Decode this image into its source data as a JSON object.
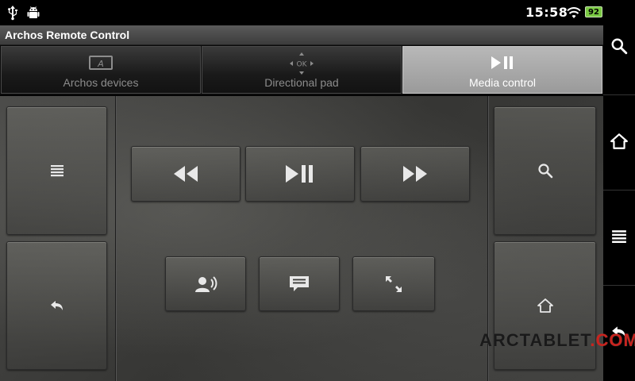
{
  "status_bar": {
    "time": "15:58",
    "battery_level": "92",
    "icons": [
      "usb-icon",
      "android-debug-icon",
      "wifi-icon",
      "battery-icon"
    ]
  },
  "app": {
    "title": "Archos Remote Control"
  },
  "tabs": [
    {
      "label": "Archos devices",
      "icon": "archos-device-icon",
      "active": false
    },
    {
      "label": "Directional pad",
      "icon": "dpad-icon",
      "dpad_center": "OK",
      "active": false
    },
    {
      "label": "Media control",
      "icon": "play-pause-icon",
      "active": true
    }
  ],
  "left_buttons": [
    {
      "icon": "menu-icon"
    },
    {
      "icon": "back-icon"
    }
  ],
  "transport_buttons": [
    {
      "icon": "rewind-icon"
    },
    {
      "icon": "play-pause-icon"
    },
    {
      "icon": "fast-forward-icon"
    }
  ],
  "function_buttons": [
    {
      "icon": "audio-track-icon"
    },
    {
      "icon": "subtitles-icon"
    },
    {
      "icon": "fullscreen-icon"
    }
  ],
  "right_buttons": [
    {
      "icon": "search-icon"
    },
    {
      "icon": "home-icon"
    }
  ],
  "system_bar": [
    {
      "icon": "search-icon"
    },
    {
      "icon": "home-icon"
    },
    {
      "icon": "menu-icon"
    },
    {
      "icon": "back-icon"
    }
  ],
  "watermark": {
    "text_main": "ARCTABLET",
    "text_accent": ".COM"
  },
  "colors": {
    "active_tab": "#a8a8a8",
    "battery": "#7ac943",
    "watermark_accent": "#c8231e"
  }
}
